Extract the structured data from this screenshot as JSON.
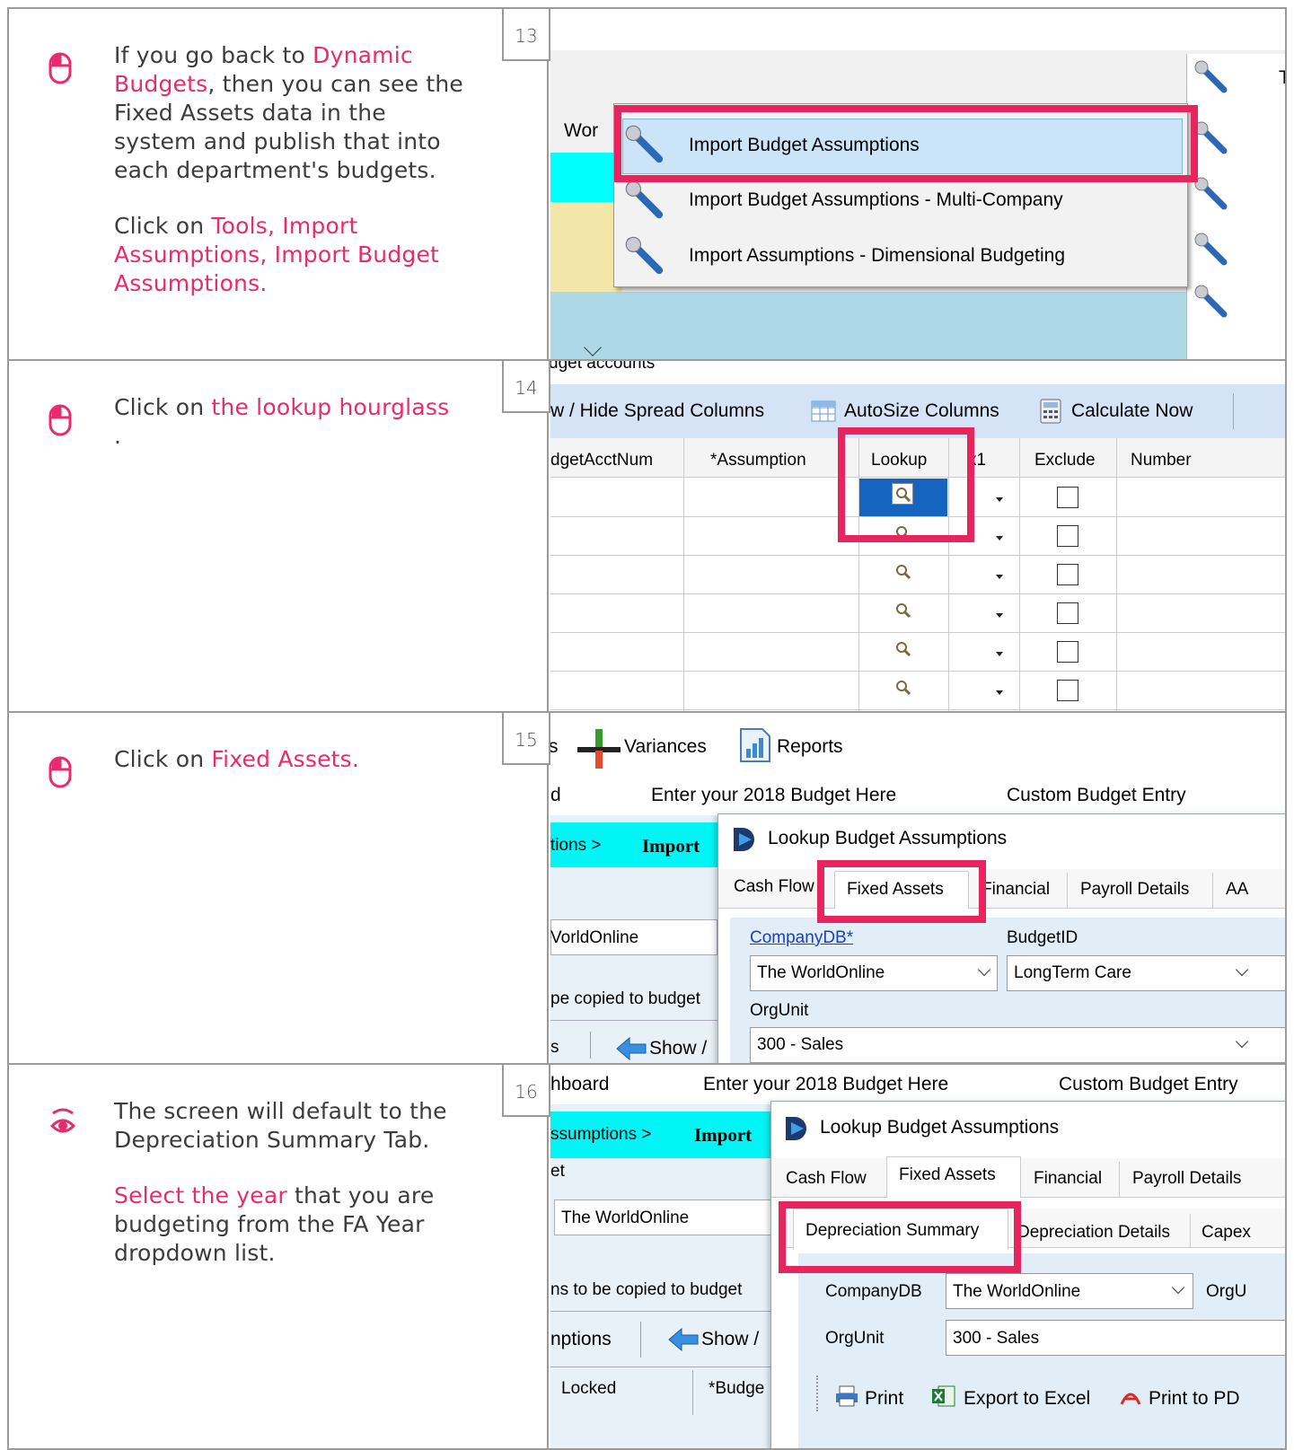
{
  "steps": [
    {
      "number": "13",
      "icon": "mouse-icon",
      "text_parts": [
        "If you go back to ",
        "Dynamic Budgets",
        ", then you can see the Fixed Assets data in the system and publish that into each department's budgets."
      ],
      "instruction_parts": [
        "Click on ",
        "Tools, Import Assumptions, Import Budget Assumptions."
      ],
      "screenshot": {
        "partial_tab": "Wor",
        "partial_menu_letter": "T",
        "menu_items": [
          "Import Budget Assumptions",
          "Import Budget Assumptions - Multi-Company",
          "Import Assumptions - Dimensional Budgeting"
        ]
      }
    },
    {
      "number": "14",
      "icon": "mouse-icon",
      "text_parts": [
        "Click on ",
        "the lookup hourglass",
        " ."
      ],
      "screenshot": {
        "partial_header": "dget accounts",
        "toolbar": [
          "w / Hide Spread Columns",
          "AutoSize Columns",
          "Calculate Now"
        ],
        "columns": [
          "dgetAcctNum",
          "*Assumption",
          "Lookup",
          "x1",
          "Exclude",
          "Number"
        ]
      }
    },
    {
      "number": "15",
      "icon": "mouse-icon",
      "text_parts": [
        "Click on ",
        "Fixed Assets."
      ],
      "screenshot": {
        "toolbar": [
          "s",
          "Variances",
          "Reports"
        ],
        "row2": [
          "d",
          "Enter your 2018 Budget Here",
          "Custom Budget Entry"
        ],
        "breadcrumb": [
          "tions  >",
          "Import"
        ],
        "left_partials": [
          "VorldOnline",
          "pe copied to budget",
          "s",
          "Show /"
        ],
        "dialog_title": "Lookup Budget Assumptions",
        "tabs": [
          "Cash Flow",
          "Fixed Assets",
          "Financial",
          "Payroll Details",
          "AA"
        ],
        "fields": {
          "company_label": "CompanyDB*",
          "company_value": "The WorldOnline",
          "budget_label": "BudgetID",
          "budget_value": "LongTerm Care",
          "org_label": "OrgUnit",
          "org_value": "300 - Sales"
        }
      }
    },
    {
      "number": "16",
      "icon": "eye-icon",
      "text_parts": [
        "The screen will default to the Depreciation Summary Tab."
      ],
      "instruction_parts": [
        "Select the year",
        " that you are budgeting from the FA Year dropdown list."
      ],
      "screenshot": {
        "row1": [
          "hboard",
          "Enter your 2018 Budget Here",
          "Custom Budget Entry"
        ],
        "breadcrumb": [
          "ssumptions  >",
          "Import"
        ],
        "left_partials": [
          "et",
          "The WorldOnline",
          "ns to be copied to budget",
          "nptions",
          "Show /",
          "Locked",
          "*Budge"
        ],
        "dialog_title": "Lookup Budget Assumptions",
        "tabs": [
          "Cash Flow",
          "Fixed Assets",
          "Financial",
          "Payroll Details"
        ],
        "subtabs": [
          "Depreciation Summary",
          "Depreciation Details",
          "Capex"
        ],
        "fields": {
          "company_label": "CompanyDB",
          "company_value": "The WorldOnline",
          "org_partial": "OrgU",
          "org_label": "OrgUnit",
          "org_value": "300 - Sales"
        },
        "actions": [
          "Print",
          "Export to Excel",
          "Print to PD"
        ]
      }
    }
  ],
  "colors": {
    "accent": "#ea2a6e",
    "highlight_box": "#e8245f",
    "border": "#9a9a9a"
  }
}
